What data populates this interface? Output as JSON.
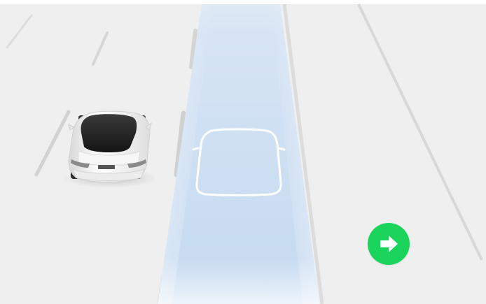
{
  "colors": {
    "road_background": "#efefef",
    "lane_marking": "#dcdcdc",
    "path_highlight_top": "#d7e6f6",
    "path_highlight_bottom": "#c8dcf2",
    "vehicle_outline": "#ffffff",
    "nav_button": "#1bd45b",
    "nav_arrow": "#ffffff",
    "car_body": "#f4f4f4",
    "car_glass": "#2b2b2b"
  },
  "icons": {
    "ego_vehicle": "ego-vehicle-outline-icon",
    "adjacent_vehicle": "adjacent-car-icon",
    "nav_arrow": "arrow-right-icon"
  }
}
